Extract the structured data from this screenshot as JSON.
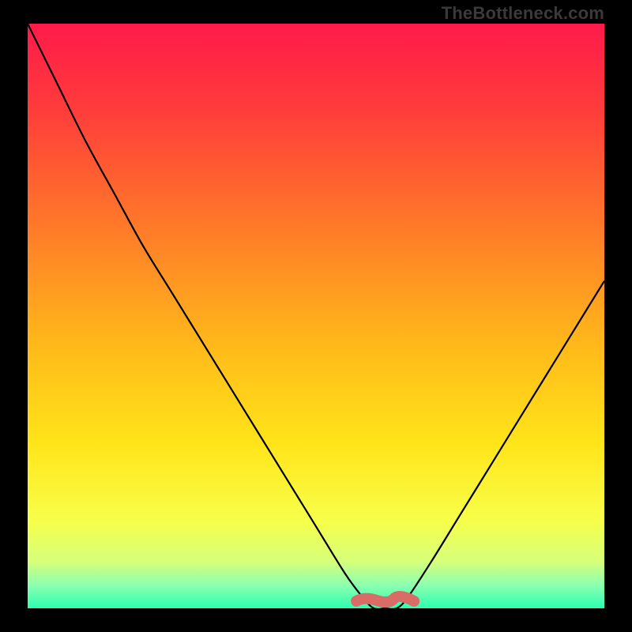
{
  "watermark": "TheBottleneck.com",
  "chart_data": {
    "type": "line",
    "title": "",
    "xlabel": "",
    "ylabel": "",
    "xlim": [
      0,
      100
    ],
    "ylim": [
      0,
      100
    ],
    "x": [
      0,
      5,
      10,
      15,
      20,
      25,
      30,
      35,
      40,
      45,
      50,
      55,
      58,
      60,
      62,
      64,
      66,
      70,
      75,
      80,
      85,
      90,
      95,
      100
    ],
    "values": [
      100,
      90,
      80,
      71,
      62,
      54,
      46,
      38,
      30,
      22,
      14,
      6,
      2,
      0,
      0,
      0,
      2,
      8,
      16,
      24,
      32,
      40,
      48,
      56
    ],
    "flat_segment": {
      "x_start": 57,
      "x_end": 67,
      "y": 1.5,
      "color": "#da6b66",
      "note": "thick coral fit-zone marker"
    },
    "gradient_stops": [
      {
        "offset": 0.0,
        "color": "#ff1a4a"
      },
      {
        "offset": 0.15,
        "color": "#ff3d3b"
      },
      {
        "offset": 0.35,
        "color": "#ff7a29"
      },
      {
        "offset": 0.55,
        "color": "#ffb91a"
      },
      {
        "offset": 0.72,
        "color": "#ffe51a"
      },
      {
        "offset": 0.85,
        "color": "#f7ff4a"
      },
      {
        "offset": 0.92,
        "color": "#d6ff7a"
      },
      {
        "offset": 0.96,
        "color": "#8cffb0"
      },
      {
        "offset": 1.0,
        "color": "#2cffb0"
      }
    ]
  }
}
